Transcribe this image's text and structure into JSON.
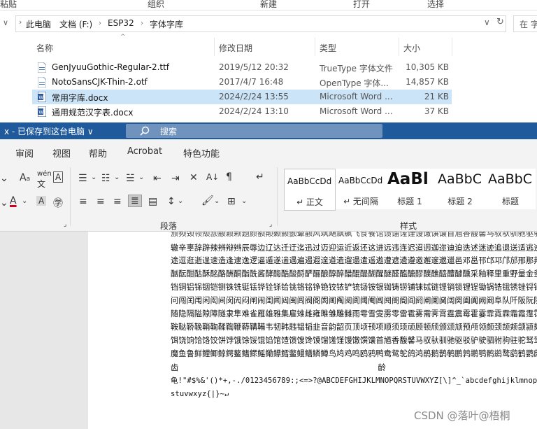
{
  "explorer": {
    "ribbon_groups": [
      "粘贴",
      "组织",
      "新建",
      "打开",
      "选择"
    ],
    "breadcrumb": [
      "此电脑",
      "文档 (F:)",
      "ESP32",
      "字体字库"
    ],
    "search_placeholder": "在 字",
    "columns": {
      "name": "名称",
      "date": "修改日期",
      "type": "类型",
      "size": "大小"
    },
    "files": [
      {
        "name": "GenJyuuGothic-Regular-2.ttf",
        "date": "2019/5/12 20:32",
        "type": "TrueType 字体文件",
        "size": "10,305 KB",
        "icon": "font-file-icon",
        "selected": false
      },
      {
        "name": "NotoSansCJK-Thin-2.otf",
        "date": "2017/4/7 16:48",
        "type": "OpenType 字体...",
        "size": "14,857 KB",
        "icon": "font-file-icon",
        "selected": false
      },
      {
        "name": "常用字库.docx",
        "date": "2024/2/24 13:55",
        "type": "Microsoft Word ...",
        "size": "21 KB",
        "icon": "word-doc-icon",
        "selected": true
      },
      {
        "name": "通用规范汉字表.docx",
        "date": "2024/2/24 13:10",
        "type": "Microsoft Word ...",
        "size": "37 KB",
        "icon": "word-doc-icon",
        "selected": false
      }
    ]
  },
  "word": {
    "title": "x - 已保存到这台电脑 ∨",
    "search_label": "搜索",
    "tabs": [
      "审阅",
      "视图",
      "帮助",
      "Acrobat",
      "特色功能"
    ],
    "groups": {
      "paragraph": "段落",
      "styles": "样式"
    },
    "styles": [
      {
        "sample": "AaBbCcDd",
        "name": "↵ 正文"
      },
      {
        "sample": "AaBbCcDd",
        "name": "↵ 无间隔"
      },
      {
        "sample": "AaBl",
        "name": "标题 1"
      },
      {
        "sample": "AaBbC",
        "name": "标题 2"
      },
      {
        "sample": "AaBbC",
        "name": "标题"
      }
    ],
    "accent_color": "#1e5a9c",
    "doc_lines": [
      "颁频颈领颓颔颛颖颗题颜额颠颡颢颤颦颧风飒飓飘飙飞食餐馆馈馏馐馑馒馓馔馕首馗香馥馨马驭驮驯驰驱驳驴驶驷驸驹驻",
      "辙辛辜辞辟辣辨辩辫辰辱边辽达迁迂迄迅过迈迎运近返还这进远违连迟迢迥迦迩迪迫迭述迷迹追退送适逃逆选逊逍透逐",
      "途逗逛逝逞速造逢逮逸逻逼遁遂遄遇遍遏遐遑道遗遛遢遣遥遨遭遮遴遵邀邂邃邈邋邑邓邕邗邙邛邝邡邢那邦邪邬邮邯邰邱",
      "酗酝酣酤酥酩酪酬酮酯酰酱酵酶酷酸酹酽酾酿醇醉醋醌醍醐醒醚醛醢醣醪醭醮醯醴醵醺采釉释里重野量金釜针钉钊钋钍",
      "铛铜铝铞铟铠铡铢铣铤铥铧铨铩铪铫铬铭铮铯铰铱铲铳铴铵银铷铸铹铺铼铽链铿销锁锂锃锄锅锆锇锈锉锊锋锌锍锎锏锐",
      "问闯闰闱闲闳间闵闶闷闸闹闺闻闼闽闾阀阁阂阃阄阅阆阈阉阊阋阌阍阎阏阐阑阒阔阕阖阗阙阚阜队阡阪阮阱防阳阴阵阶",
      "随隐隔隘隙障隧隶隼难雀雁雄雅集雇雉雌雍雎雏雕雠雨雩雪雯雳零雷雹雾需霁霄霆震霉霍霎霏霓霖霜霞霪霭霰露霸霹霾",
      "鞍鞑鞒鞔鞘鞠鞣鞫鞭鞯鞲鞴韦韧韩韪韫韬韭音韵韶页顶顷顸项顺须顼顽顾顿颀颁颂颃预颅领颇颈颉颊颌颍颏颐频颓颔颖",
      "饵饶饷饸饹饺饼饽饿馀馁馄馅馆馇馈馊馋馍馏馐馑馒馓馔馕首馗香馥馨马驭驮驯驰驱驳驴驶驷驸驹驻驼驽驾驿骀骁骂",
      "魔鱼鲁鲜鲤鲫鲸鳄鳌鳍鳏鳐鳓鳔鳕鳖鳗鳝鳞鳟鸟鸠鸡鸣鸥鸦鸭鸯鸳鸵鸽鸿鹃鹅鹊鹌鹏鹑鹕鹗鹘鹚鹜鹞鹤鹦鹧鹫鹭鹰鹿麋麒",
      "齿                                                                              龄",
      "龟!\"#$%&'()*+,-./0123456789:;<=>?@ABCDEFGHIJKLMNOPQRSTUVWXYZ[\\]^_`abcdefghijklmnopqr",
      "stuvwxyz{|}~↵"
    ]
  },
  "watermark": "CSDN @落叶@梧桐"
}
